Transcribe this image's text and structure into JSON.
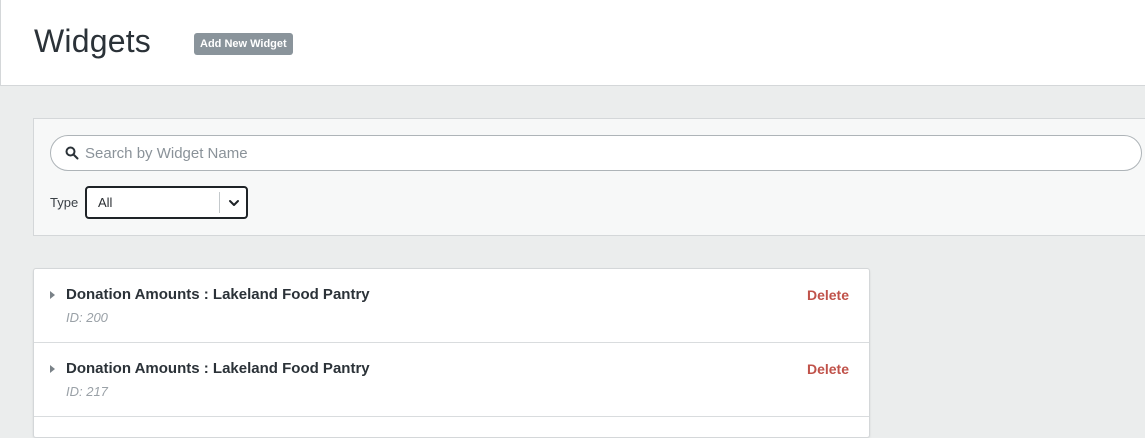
{
  "header": {
    "title": "Widgets",
    "add_button_label": "Add New Widget"
  },
  "filters": {
    "search_placeholder": "Search by Widget Name",
    "search_value": "",
    "type_label": "Type",
    "type_selected": "All"
  },
  "widgets": [
    {
      "name": "Donation Amounts : Lakeland Food Pantry",
      "id_text": "ID: 200",
      "delete_label": "Delete"
    },
    {
      "name": "Donation Amounts : Lakeland Food Pantry",
      "id_text": "ID: 217",
      "delete_label": "Delete"
    }
  ],
  "colors": {
    "header_bg": "#ffffff",
    "page_bg": "#ebeded",
    "add_button_bg": "#8a949b",
    "delete_text": "#c0524a"
  },
  "icons": {
    "search": "search-icon",
    "select_chevron": "chevron-down-icon",
    "expand": "caret-right-icon"
  }
}
